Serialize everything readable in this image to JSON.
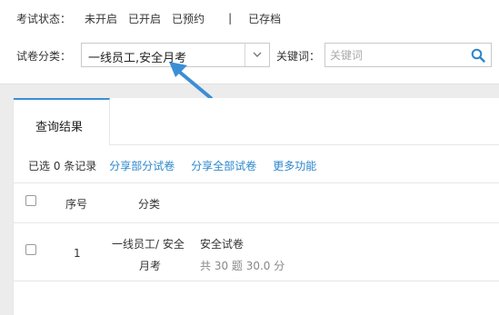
{
  "filter": {
    "status_label": "考试状态：",
    "status_options": [
      "未开启",
      "已开启",
      "已预约"
    ],
    "status_separator": "|",
    "status_archived": "已存档",
    "category_label": "试卷分类：",
    "category_value": "一线员工,安全月考",
    "keyword_label": "关键词：",
    "keyword_placeholder": "关键词",
    "keyword_value": ""
  },
  "results": {
    "tab_label": "查询结果",
    "selected_count": "已选 0 条记录",
    "actions": [
      "分享部分试卷",
      "分享全部试卷",
      "更多功能"
    ],
    "columns": [
      "序号",
      "分类"
    ],
    "rows": [
      {
        "index": "1",
        "category_line1": "一线员工/ 安全",
        "category_line2": "月考",
        "title": "安全试卷",
        "summary": "共 30 题 30.0 分"
      }
    ]
  },
  "colors": {
    "accent": "#3b8ed6",
    "link": "#2b86cc",
    "search_icon": "#2b86cc",
    "arrow": "#3b8ed6"
  }
}
